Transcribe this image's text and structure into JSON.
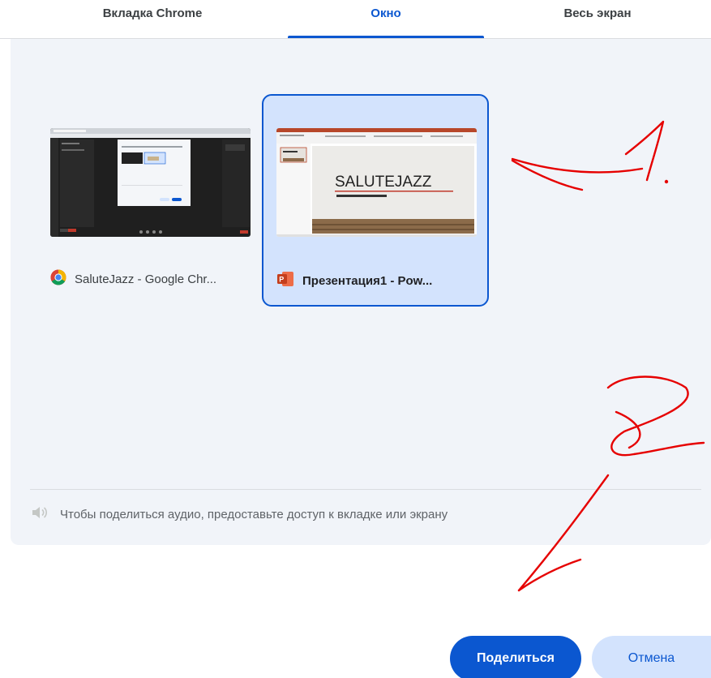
{
  "tabs": [
    {
      "label": "Вкладка Chrome"
    },
    {
      "label": "Окно",
      "selected": true
    },
    {
      "label": "Весь экран"
    }
  ],
  "windows": [
    {
      "title": "SaluteJazz - Google Chr...",
      "icon": "chrome-icon"
    },
    {
      "title": "Презентация1 - Pow...",
      "icon": "powerpoint-icon",
      "selected": true,
      "thumbnail_text": "SALUTEJAZZ"
    }
  ],
  "audio_note": "Чтобы поделиться аудио, предоставьте доступ к вкладке или экрану",
  "buttons": {
    "share": "Поделиться",
    "cancel": "Отмена"
  },
  "colors": {
    "accent": "#0b57d0",
    "selected_bg": "#d3e3fd",
    "panel_bg": "#f1f4f9",
    "annotation": "#e60000"
  }
}
